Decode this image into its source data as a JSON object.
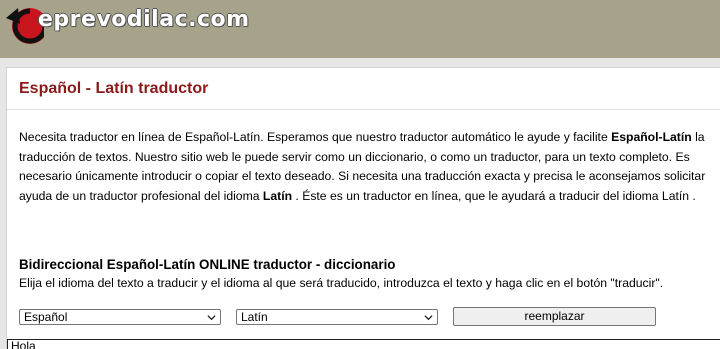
{
  "header": {
    "logo_text": "eprevodilac.com",
    "brand_color": "#a7a28a"
  },
  "page": {
    "title": "Español - Latín traductor",
    "title_color": "#8b1a1a",
    "intro": {
      "p1": "Necesita traductor en línea de Español-Latín. Esperamos que nuestro traductor automático le ayude y facilite ",
      "b1": "Español-Latín",
      "p2": " la traducción de textos. Nuestro sitio web le puede servir como un diccionario, o como un traductor, para un texto completo. Es necesario únicamente introducir o copiar el texto deseado. Si necesita una traducción exacta y precisa le aconsejamos solicitar ayuda de un traductor profesional del idioma ",
      "b2": "Latín",
      "p3": " . Éste es un traductor en línea, que le ayudará a traducir del idioma Latín ."
    },
    "section_title": "Bidireccional Español-Latín ONLINE traductor - diccionario",
    "section_desc": "Elija el idioma del texto a traducir y el idioma al que será traducido, introduzca el texto y haga clic en el botón \"traducir\"."
  },
  "translator": {
    "source_language": "Español",
    "target_language": "Latín",
    "swap_button_label": "reemplazar",
    "input_text": "Hola"
  }
}
